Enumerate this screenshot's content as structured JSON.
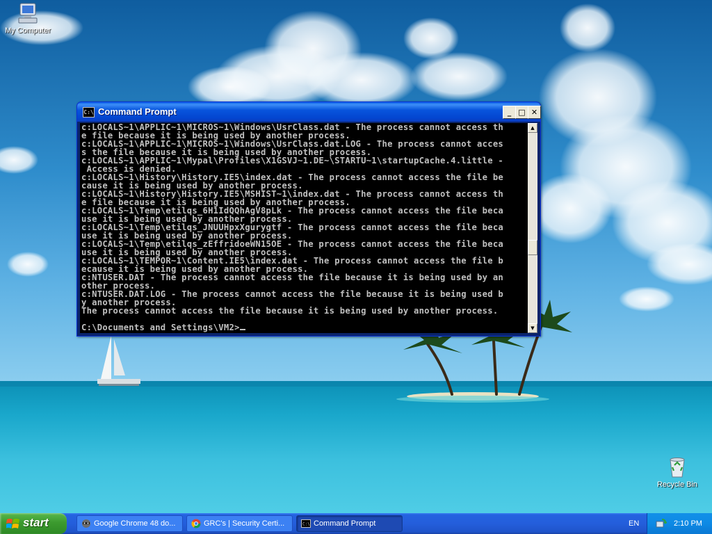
{
  "desktop": {
    "icons": [
      {
        "label": "My Computer",
        "icon": "computer-icon"
      },
      {
        "label": "Recycle Bin",
        "icon": "recycle-bin-icon"
      }
    ]
  },
  "window": {
    "title": "Command Prompt",
    "icon": "cmd-icon",
    "console_lines": [
      "c:LOCALS~1\\APPLIC~1\\MICROS~1\\Windows\\UsrClass.dat - The process cannot access th",
      "e file because it is being used by another process.",
      "c:LOCALS~1\\APPLIC~1\\MICROS~1\\Windows\\UsrClass.dat.LOG - The process cannot acces",
      "s the file because it is being used by another process.",
      "c:LOCALS~1\\APPLIC~1\\Mypal\\Profiles\\X1GSVJ~1.DE~\\STARTU~1\\startupCache.4.little -",
      " Access is denied.",
      "c:LOCALS~1\\History\\History.IE5\\index.dat - The process cannot access the file be",
      "cause it is being used by another process.",
      "c:LOCALS~1\\History\\History.IE5\\MSHIST~1\\index.dat - The process cannot access th",
      "e file because it is being used by another process.",
      "c:LOCALS~1\\Temp\\etilqs_6H1IdQQhAgV8pLk - The process cannot access the file beca",
      "use it is being used by another process.",
      "c:LOCALS~1\\Temp\\etilqs_JNUUHpxXgurygtf - The process cannot access the file beca",
      "use it is being used by another process.",
      "c:LOCALS~1\\Temp\\etilqs_zEffridoeWN15OE - The process cannot access the file beca",
      "use it is being used by another process.",
      "c:LOCALS~1\\TEMPOR~1\\Content.IE5\\index.dat - The process cannot access the file b",
      "ecause it is being used by another process.",
      "c:NTUSER.DAT - The process cannot access the file because it is being used by an",
      "other process.",
      "c:NTUSER.DAT.LOG - The process cannot access the file because it is being used b",
      "y another process.",
      "The process cannot access the file because it is being used by another process.",
      ""
    ],
    "prompt": "C:\\Documents and Settings\\VM2>"
  },
  "taskbar": {
    "start_label": "start",
    "tasks": [
      {
        "label": "Google Chrome 48 do...",
        "icon": "raccoon-app-icon",
        "active": false
      },
      {
        "label": "GRC's | Security Certi...",
        "icon": "chrome-icon",
        "active": false
      },
      {
        "label": "Command Prompt",
        "icon": "cmd-icon",
        "active": true
      }
    ],
    "language": "EN",
    "clock": "2:10 PM"
  }
}
